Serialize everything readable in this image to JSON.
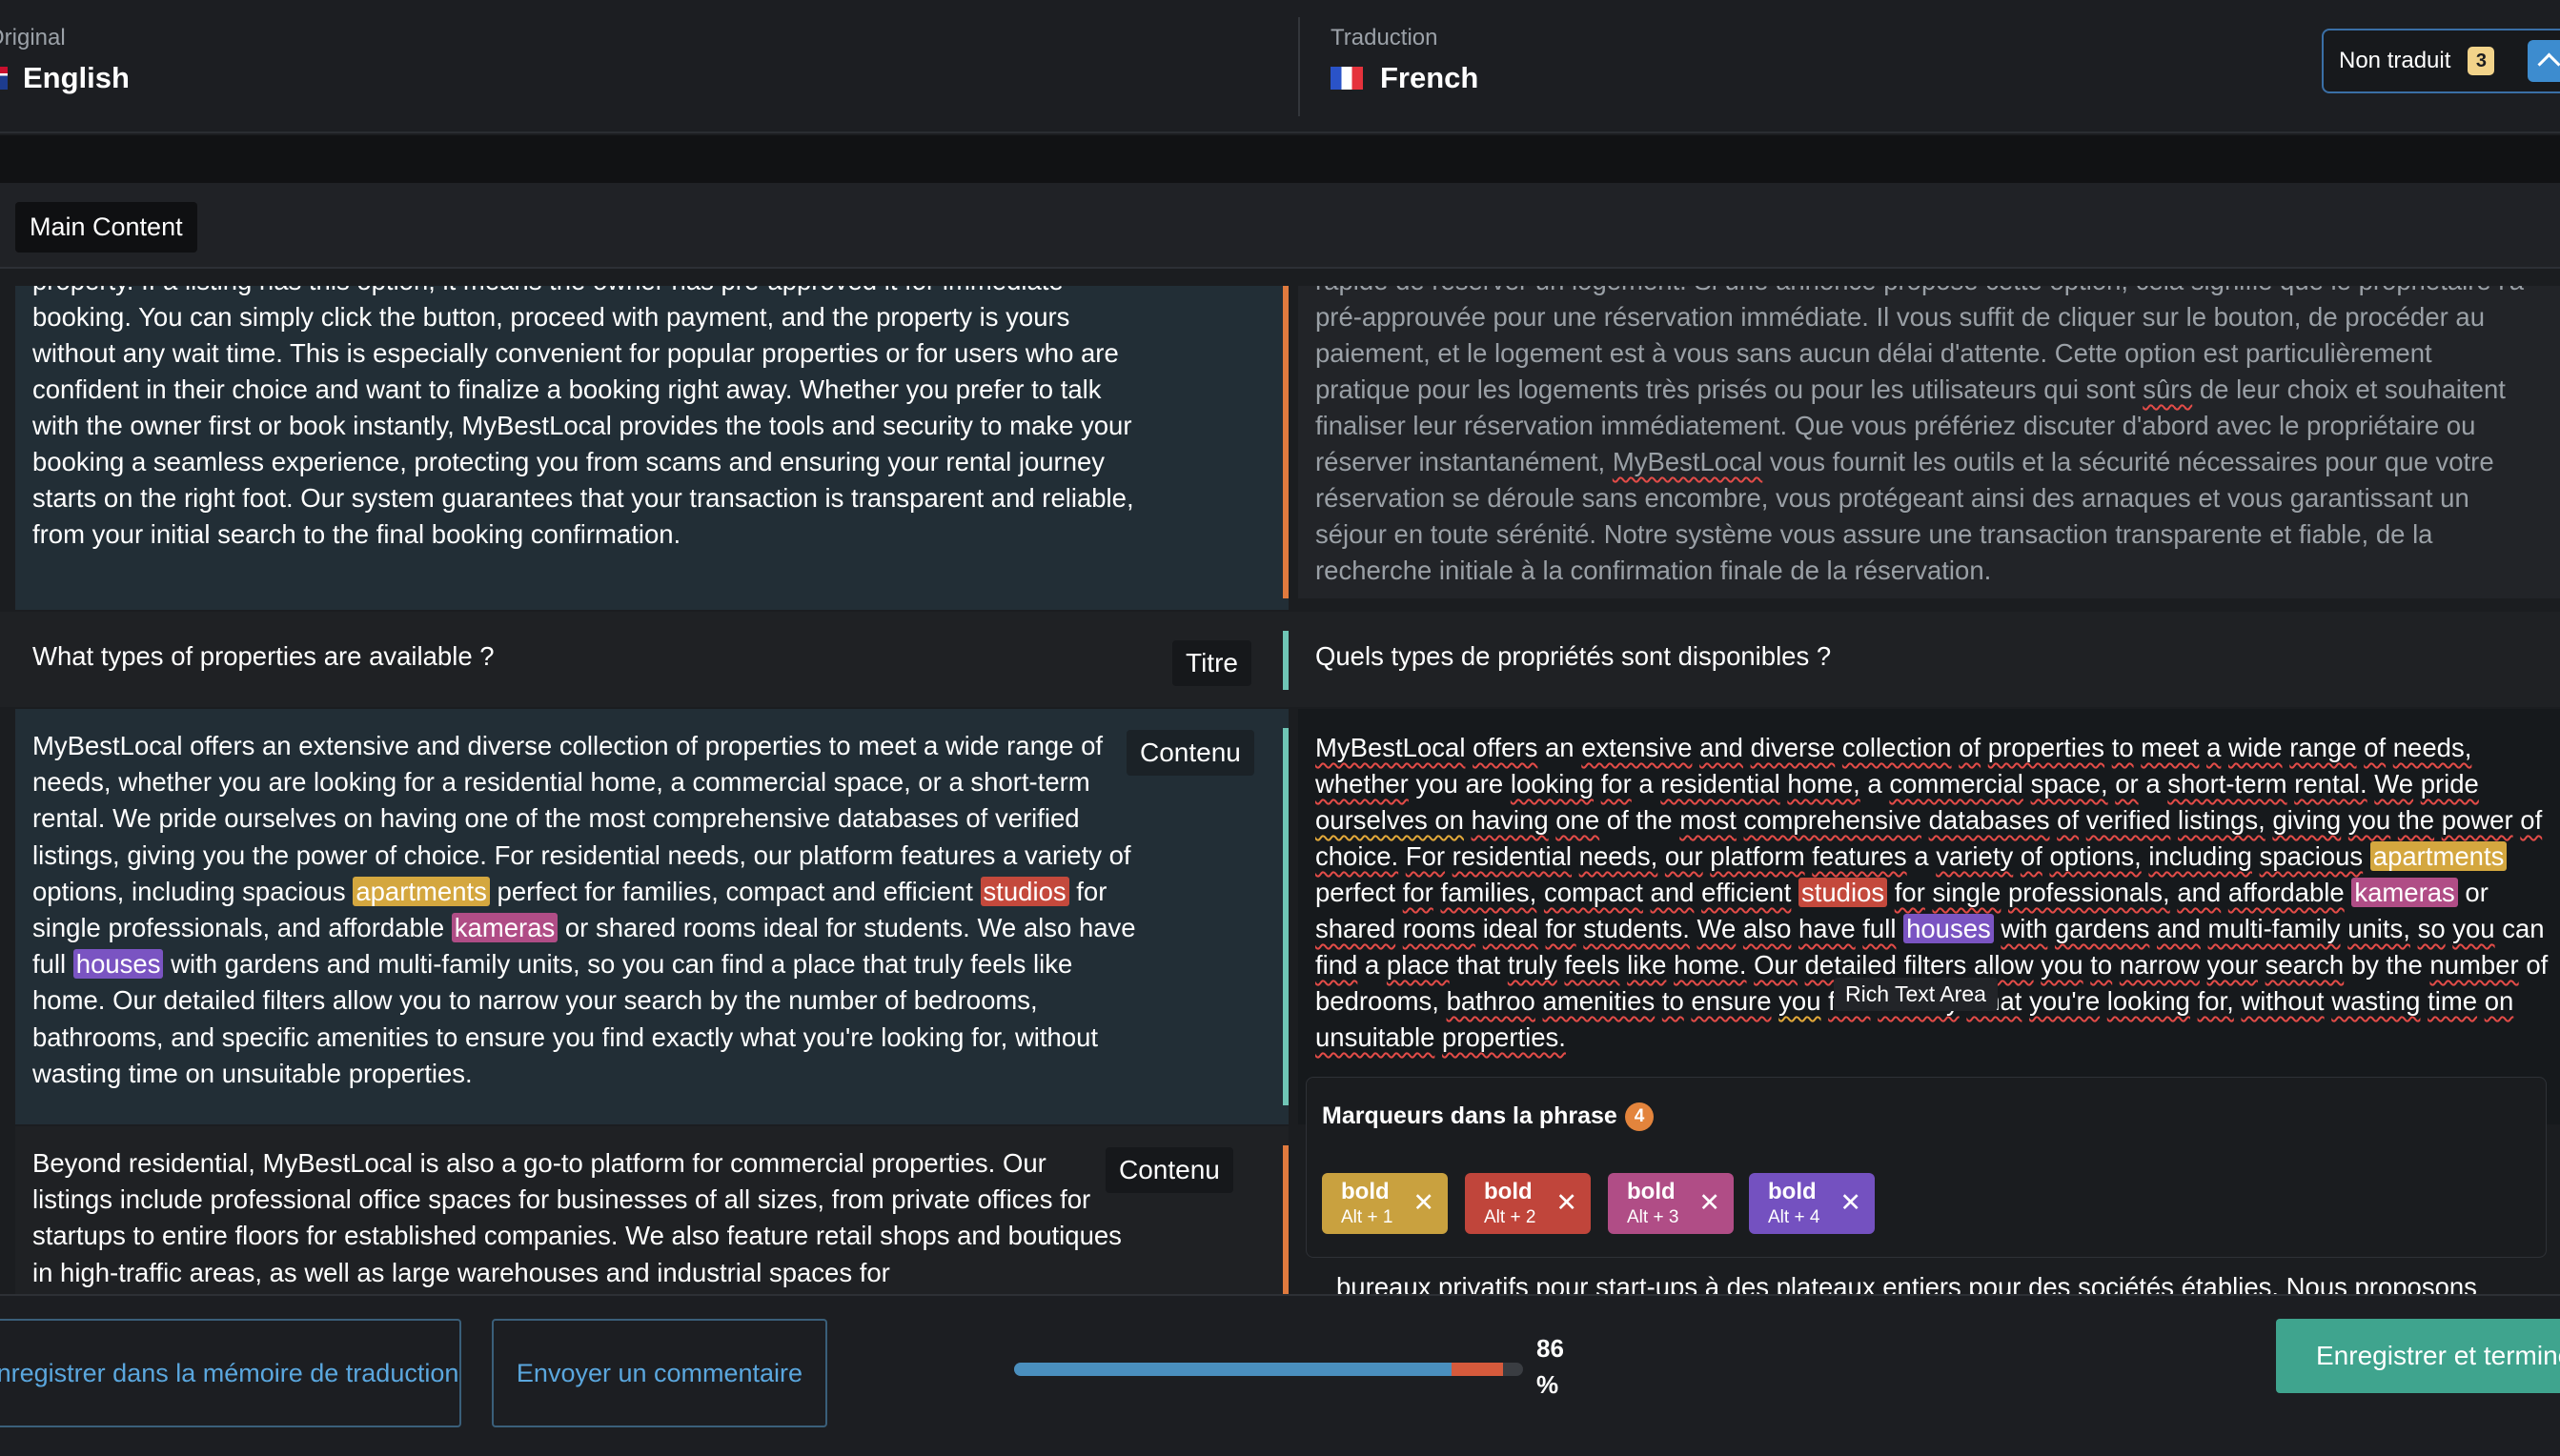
{
  "header": {
    "source_label": "Original",
    "source_language": "English",
    "target_label": "Traduction",
    "target_language": "French",
    "filter_label": "Non traduit",
    "filter_count": "3"
  },
  "section": {
    "label": "Main Content"
  },
  "rows": {
    "r1": {
      "source": "property. If a listing has this option, it means the owner has pre-approved it for immediate booking. You can simply click the button, proceed with payment, and the property is yours without any wait time. This is especially convenient for popular properties or for users who are confident in their choice and want to finalize a booking right away. Whether you prefer to talk with the owner first or book instantly, MyBestLocal provides the tools and security to make your booking a seamless experience, protecting you from scams and ensuring your rental journey starts on the right foot. Our system guarantees that your transaction is transparent and reliable, from your initial search to the final booking confirmation.",
      "target_l0": "rapide de réserver un logement. Si une annonce propose cette option, cela signifie que le propriétaire l'a",
      "target_l1": "pré-approuvée pour une réservation immédiate. Il vous suffit de cliquer sur le bouton, de procéder au",
      "target_l2": "paiement, et le logement est à vous sans aucun délai d'attente. Cette option est particulièrement",
      "target_l3a": "pratique pour les logements très prisés ou pour les utilisateurs qui sont ",
      "target_l3_sq": "sûrs",
      "target_l3b": " de leur choix et souhaitent",
      "target_l4": "finaliser leur réservation immédiatement. Que vous préfériez discuter d'abord avec le propriétaire ou",
      "target_l5a": "réserver instantanément, ",
      "target_l5_sq": "MyBestLocal",
      "target_l5b": " vous fournit les outils et la sécurité nécessaires pour que votre",
      "target_l6": "réservation se déroule sans encombre, vous protégeant ainsi des arnaques et vous garantissant un",
      "target_l7": "séjour en toute sérénité. Notre système vous assure une transaction transparente et fiable, de la",
      "target_l8": "recherche initiale à la confirmation finale de la réservation."
    },
    "r2": {
      "source": "What types of properties are available ?",
      "tag": "Titre",
      "target": "Quels types de propriétés sont disponibles ?"
    },
    "r3": {
      "tag": "Contenu",
      "source_a": "MyBestLocal offers an extensive and diverse collection of properties to meet a wide range of needs, whether you are looking for a residential home, a commercial space, or a short-term rental. We pride ourselves on having one of the most comprehensive databases of verified listings, giving you the power of choice. For residential needs, our platform features a variety of options, including spacious ",
      "hl_1": "apartments",
      "source_b": " perfect for families, compact and efficient ",
      "hl_2": "studios",
      "source_c": " for single professionals, and affordable ",
      "hl_3": "kameras",
      "source_d": " or shared rooms ideal for students. We also have full ",
      "hl_4": "houses",
      "source_e": " with gardens and multi-family units, so you can find a place that truly feels like home. Our detailed filters allow you to narrow your search by the number of bedrooms, bathrooms, and specific amenities to ensure you find exactly what you're looking for, without wasting time on unsuitable properties."
    },
    "r4": {
      "tag": "Contenu",
      "source": "Beyond residential, MyBestLocal is also a go-to platform for commercial properties. Our listings include professional office spaces for businesses of all sizes, from private offices for startups to entire floors for established companies. We also feature retail shops and boutiques in high-traffic areas, as well as large warehouses and industrial spaces for",
      "target": "bureaux privatifs pour start-ups à des plateaux entiers pour des sociétés établies. Nous proposons"
    }
  },
  "editor": {
    "w": [
      "MyBestLocal",
      "offers",
      "an",
      "extensive",
      "and",
      "diverse",
      "collection",
      "of",
      "properties",
      "to",
      "meet",
      "a",
      "wide",
      "range",
      "of",
      "needs,",
      "whether",
      "you",
      "are",
      "looking",
      "for",
      "a",
      "residential",
      "home,",
      "a",
      "commercial",
      "space,",
      "or",
      "a",
      "short-term",
      "rental.",
      "We",
      "pride",
      "ourselves on",
      "having",
      "one",
      "of",
      "the",
      "most",
      "comprehensive",
      "databases",
      "of",
      "verified",
      "listings,",
      "giving",
      "you",
      "the",
      "power",
      "of choice.",
      "For",
      "residential",
      "needs,",
      "our",
      "platform",
      "features",
      "a",
      "variety",
      "of",
      "options,",
      "including",
      "spacious",
      "apartments",
      "perfect",
      "for",
      "families,",
      "compact",
      "and",
      "efficient",
      "studios",
      "for",
      "single",
      "professionals,",
      "and",
      "affordable",
      "kameras",
      "or",
      "shared",
      "rooms",
      "ideal",
      "for",
      "students.",
      "We",
      "also",
      "have",
      "full",
      "houses",
      "with",
      "gardens",
      "and",
      "multi-family",
      "units,",
      "so",
      "you",
      "can",
      "find",
      "a",
      "place",
      "that",
      "truly",
      "feels",
      "like",
      "home.",
      "Our",
      "detailed",
      "filters",
      "allow",
      "you",
      "to",
      "narrow",
      "your",
      "search",
      "by",
      "the",
      "number",
      "of",
      "bedrooms,",
      "bathroo",
      "amenities",
      "to",
      "ensure",
      "you",
      "find",
      "exactly",
      "what",
      "you're",
      "looking",
      "for,",
      "without",
      "wasting",
      "time",
      "on",
      "unsuitable",
      "properties."
    ],
    "tooltip": "Rich Text Area"
  },
  "markers": {
    "title": "Marqueurs dans la phrase",
    "count": "4",
    "items": [
      {
        "label": "bold",
        "shortcut": "Alt + 1",
        "color": "#c9a13f"
      },
      {
        "label": "bold",
        "shortcut": "Alt + 2",
        "color": "#c0453b"
      },
      {
        "label": "bold",
        "shortcut": "Alt + 3",
        "color": "#b04d86"
      },
      {
        "label": "bold",
        "shortcut": "Alt + 4",
        "color": "#7451c0"
      }
    ],
    "remove_glyph": "✕"
  },
  "footer": {
    "save_memory": "Enregistrer dans la mémoire de traduction",
    "send_comment": "Envoyer un commentaire",
    "progress_percent": 86,
    "progress_value": "86",
    "progress_unit": "%",
    "save_finish": "Enregistrer et terminer"
  },
  "colors": {
    "accent_blue": "#3d8ccf",
    "accent_green": "#3fa48e",
    "error_red": "#d65a3c",
    "highlight_yellow": "#d4a73f",
    "highlight_red": "#c4493c",
    "highlight_magenta": "#b04d86",
    "highlight_purple": "#7a54c2",
    "bar_teal": "#6fc5b5",
    "bar_orange": "#e07a3e"
  },
  "icons": {
    "filter_toggle": "chevron-up-icon",
    "source_flag": "uk-flag-icon",
    "target_flag": "france-flag-icon",
    "marker_remove": "close-icon"
  }
}
